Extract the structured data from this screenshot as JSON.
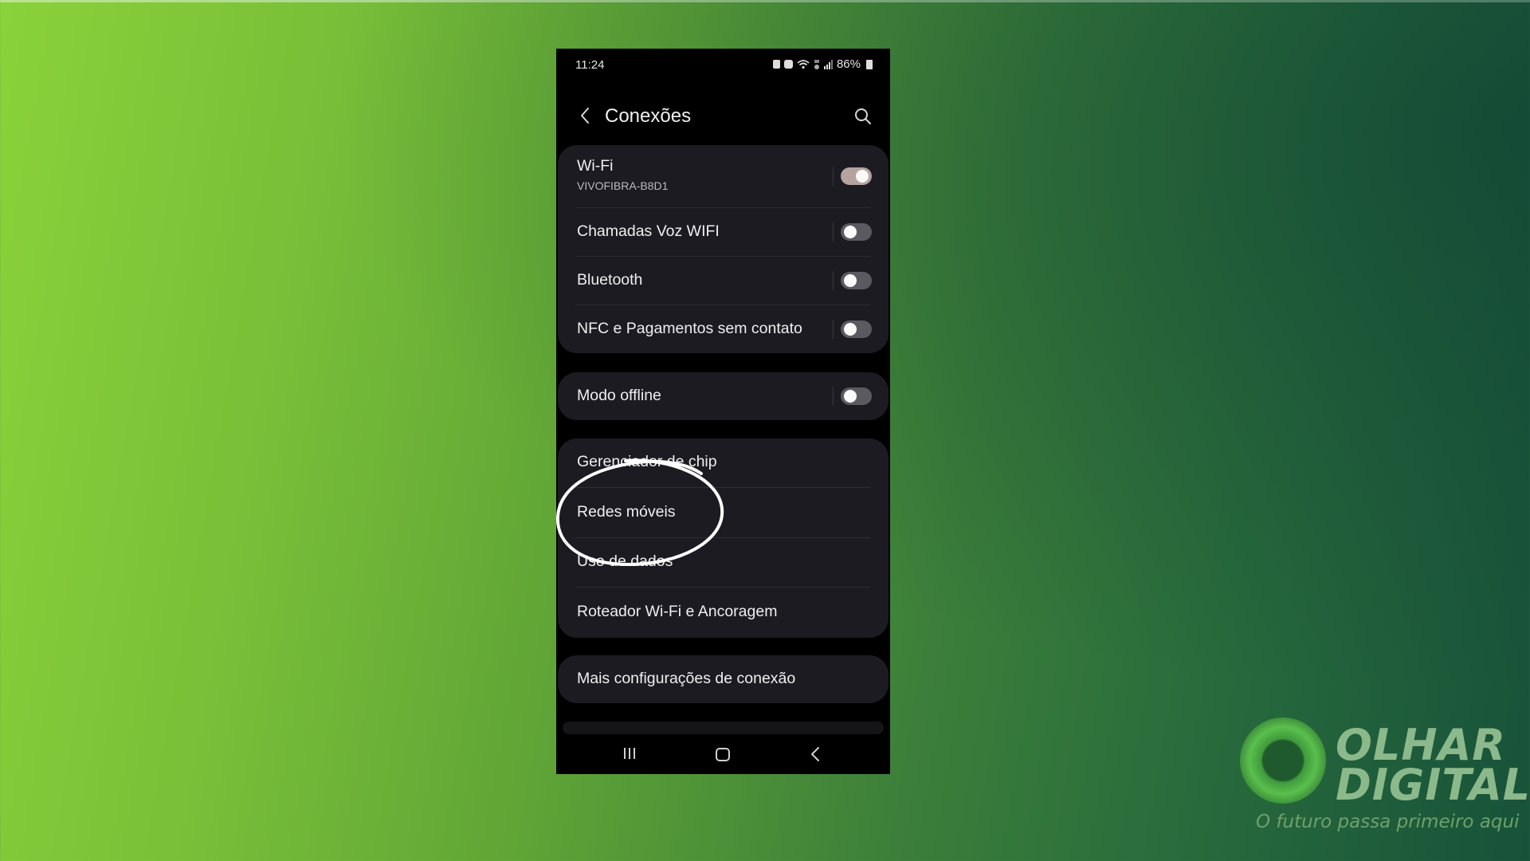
{
  "status_bar": {
    "time": "11:24",
    "icons": [
      "sim-icon",
      "alarm-icon",
      "wifi-icon",
      "data-icon",
      "signal-icon"
    ],
    "battery": "86%"
  },
  "header": {
    "title": "Conexões",
    "back_icon": "chevron-left-icon",
    "search_icon": "search-icon"
  },
  "groups": [
    {
      "items": [
        {
          "label": "Wi-Fi",
          "subtitle": "VIVOFIBRA-B8D1",
          "toggle": true
        },
        {
          "label": "Chamadas Voz WIFI",
          "toggle": false
        },
        {
          "label": "Bluetooth",
          "toggle": false
        },
        {
          "label": "NFC e Pagamentos sem contato",
          "toggle": false
        }
      ]
    },
    {
      "items": [
        {
          "label": "Modo offline",
          "toggle": false
        }
      ]
    },
    {
      "items": [
        {
          "label": "Gerenciador de chip"
        },
        {
          "label": "Redes móveis",
          "highlighted": true
        },
        {
          "label": "Uso de dados"
        },
        {
          "label": "Roteador Wi-Fi e Ancoragem"
        }
      ]
    },
    {
      "items": [
        {
          "label": "Mais configurações de conexão"
        }
      ]
    }
  ],
  "nav_bar": {
    "recents": "recents-icon",
    "home": "home-icon",
    "back": "back-icon"
  },
  "annotation": {
    "type": "circle",
    "target": "Redes móveis",
    "color": "#ffffff"
  },
  "watermark": {
    "line1": "OLHAR",
    "line2": "DIGITAL",
    "tagline": "O futuro passa primeiro aqui"
  },
  "colors": {
    "background_start": "#8ad23a",
    "background_end": "#17523a",
    "card": "#1c1b22",
    "toggle_on": "#b6a3a0",
    "toggle_off": "#5b5a60"
  }
}
